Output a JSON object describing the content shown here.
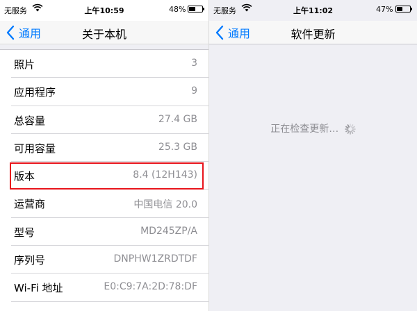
{
  "left": {
    "status": {
      "carrier": "无服务",
      "time": "上午10:59",
      "battery_pct": "48%",
      "battery_level": 0.48
    },
    "nav": {
      "back_label": "通用",
      "title": "关于本机"
    },
    "rows": [
      {
        "label": "照片",
        "value": "3"
      },
      {
        "label": "应用程序",
        "value": "9"
      },
      {
        "label": "总容量",
        "value": "27.4 GB"
      },
      {
        "label": "可用容量",
        "value": "25.3 GB"
      },
      {
        "label": "版本",
        "value": "8.4 (12H143)"
      },
      {
        "label": "运营商",
        "value": "中国电信 20.0"
      },
      {
        "label": "型号",
        "value": "MD245ZP/A"
      },
      {
        "label": "序列号",
        "value": "DNPHW1ZRDTDF"
      },
      {
        "label": "Wi-Fi 地址",
        "value": "E0:C9:7A:2D:78:DF"
      }
    ]
  },
  "right": {
    "status": {
      "carrier": "无服务",
      "time": "上午11:02",
      "battery_pct": "47%",
      "battery_level": 0.47
    },
    "nav": {
      "back_label": "通用",
      "title": "软件更新"
    },
    "checking_text": "正在检查更新…"
  },
  "colors": {
    "accent": "#007aff",
    "highlight": "#e8141b",
    "secondary_text": "#8e8e93"
  }
}
